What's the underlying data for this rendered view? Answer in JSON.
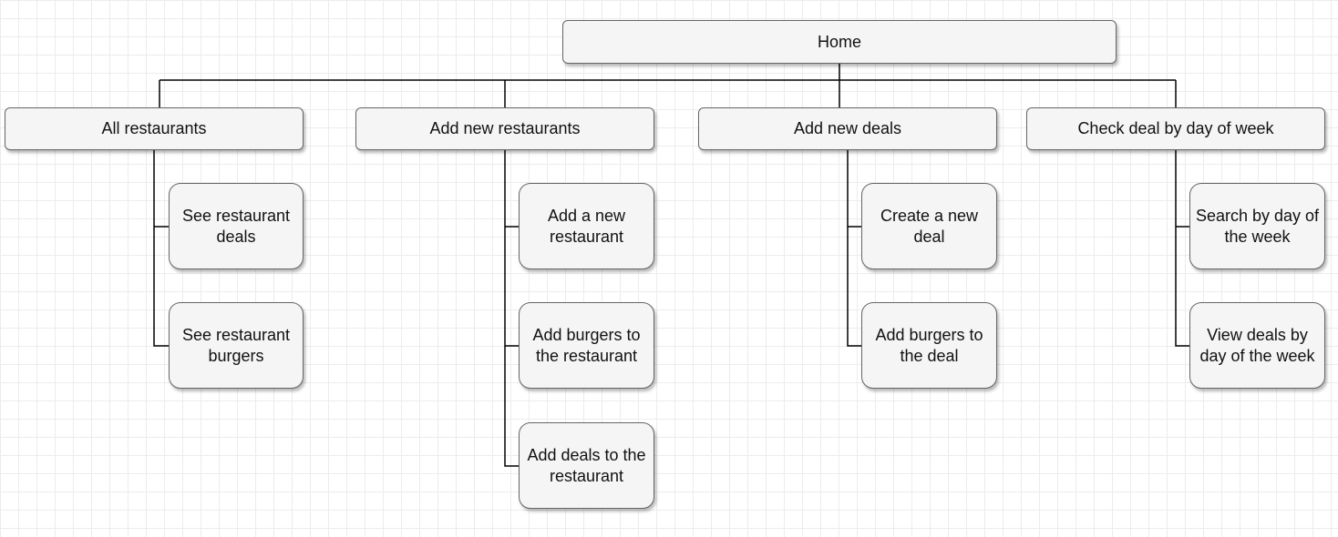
{
  "root": {
    "label": "Home"
  },
  "sections": [
    {
      "label": "All restaurants",
      "children": [
        {
          "label": "See restaurant deals"
        },
        {
          "label": "See restaurant burgers"
        }
      ]
    },
    {
      "label": "Add new restaurants",
      "children": [
        {
          "label": "Add a new restaurant"
        },
        {
          "label": "Add burgers to the restaurant"
        },
        {
          "label": "Add deals to the restaurant"
        }
      ]
    },
    {
      "label": "Add new deals",
      "children": [
        {
          "label": "Create a new deal"
        },
        {
          "label": "Add burgers to the deal"
        }
      ]
    },
    {
      "label": "Check deal by day of week",
      "children": [
        {
          "label": "Search by day of the week"
        },
        {
          "label": "View deals by day of the week"
        }
      ]
    }
  ],
  "colors": {
    "node_fill": "#f5f5f5",
    "node_stroke": "#666666",
    "connector": "#000000",
    "grid": "#ececec"
  }
}
